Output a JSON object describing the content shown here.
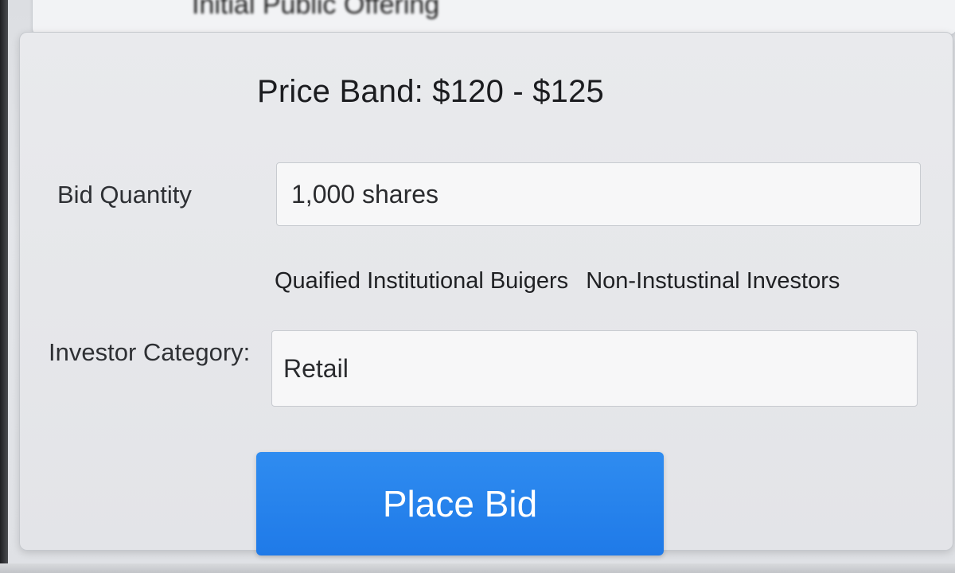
{
  "top_card": {
    "title": "Initial Public Offering"
  },
  "form": {
    "price_band": "Price Band: $120 - $125",
    "bid_quantity_label": "Bid Quantity",
    "bid_quantity_value": "1,000 shares",
    "category_options": [
      "Quaified Institutional Buigers",
      "Non-Instustinal Investors"
    ],
    "investor_category_label": "Investor Category:",
    "investor_category_value": "Retail",
    "place_bid_label": "Place Bid"
  },
  "colors": {
    "accent": "#1f7ae8"
  }
}
